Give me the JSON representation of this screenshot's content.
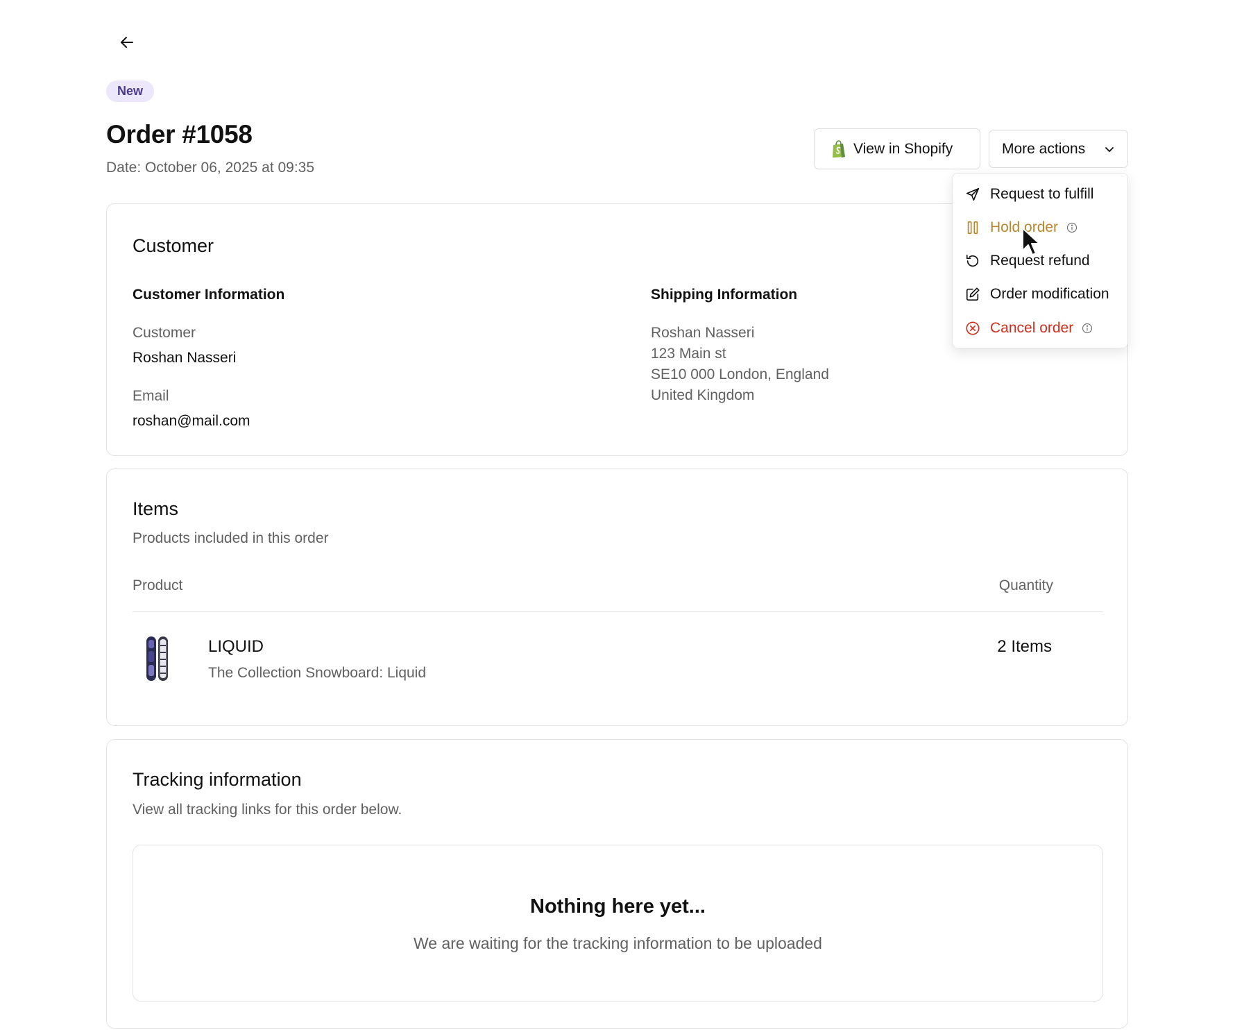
{
  "header": {
    "badge": "New",
    "title": "Order #1058",
    "date": "Date: October 06, 2025 at 09:35",
    "view_shopify_label": "View in Shopify",
    "more_actions_label": "More actions"
  },
  "menu": {
    "items": [
      {
        "label": "Request to fulfill",
        "icon": "send-icon"
      },
      {
        "label": "Hold order",
        "icon": "pause-icon",
        "color": "#b7862f",
        "info": true
      },
      {
        "label": "Request refund",
        "icon": "refresh-icon"
      },
      {
        "label": "Order modification",
        "icon": "edit-icon"
      },
      {
        "label": "Cancel order",
        "icon": "x-circle-icon",
        "color": "#d22d1d",
        "info": true
      }
    ]
  },
  "customer": {
    "title": "Customer",
    "info_heading": "Customer Information",
    "customer_label": "Customer",
    "customer_name": "Roshan Nasseri",
    "email_label": "Email",
    "email": "roshan@mail.com",
    "shipping_heading": "Shipping Information",
    "address": [
      "Roshan Nasseri",
      "123 Main st",
      "SE10 000 London, England",
      "United Kingdom"
    ]
  },
  "items": {
    "title": "Items",
    "subtitle": "Products included in this order",
    "col_product": "Product",
    "col_quantity": "Quantity",
    "rows": [
      {
        "name": "LIQUID",
        "description": "The Collection Snowboard: Liquid",
        "quantity": "2 Items"
      }
    ]
  },
  "tracking": {
    "title": "Tracking information",
    "subtitle": "View all tracking links for this order below.",
    "empty_title": "Nothing here yet...",
    "empty_sub": "We are waiting for the tracking information to be uploaded"
  },
  "colors": {
    "hold": "#b7862f",
    "cancel": "#d22d1d",
    "badge_bg": "#ece7fb",
    "badge_text": "#4a3c8c",
    "shopify_green": "#95bf47"
  }
}
